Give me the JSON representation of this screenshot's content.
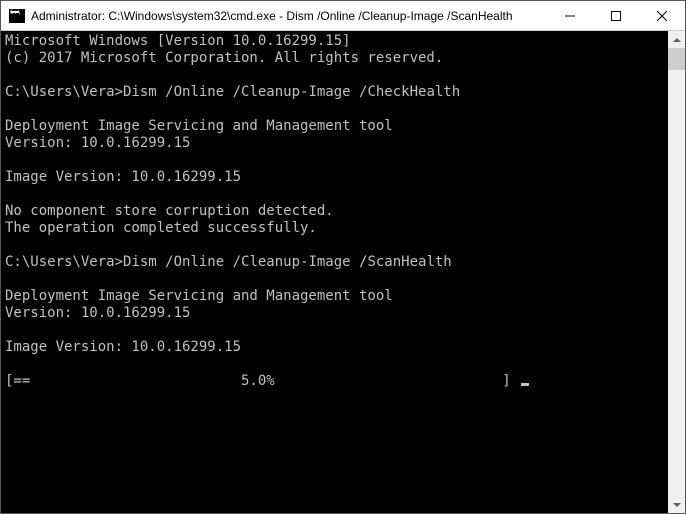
{
  "titlebar": {
    "title": "Administrator: C:\\Windows\\system32\\cmd.exe - Dism  /Online /Cleanup-Image /ScanHealth"
  },
  "terminal": {
    "header1": "Microsoft Windows [Version 10.0.16299.15]",
    "header2": "(c) 2017 Microsoft Corporation. All rights reserved.",
    "prompt1": "C:\\Users\\Vera>",
    "command1": "Dism /Online /Cleanup-Image /CheckHealth",
    "tool_name": "Deployment Image Servicing and Management tool",
    "tool_version": "Version: 10.0.16299.15",
    "image_version": "Image Version: 10.0.16299.15",
    "result1": "No component store corruption detected.",
    "result2": "The operation completed successfully.",
    "prompt2": "C:\\Users\\Vera>",
    "command2": "Dism /Online /Cleanup-Image /ScanHealth",
    "progress_line": "[==                         5.0%                           ] "
  }
}
